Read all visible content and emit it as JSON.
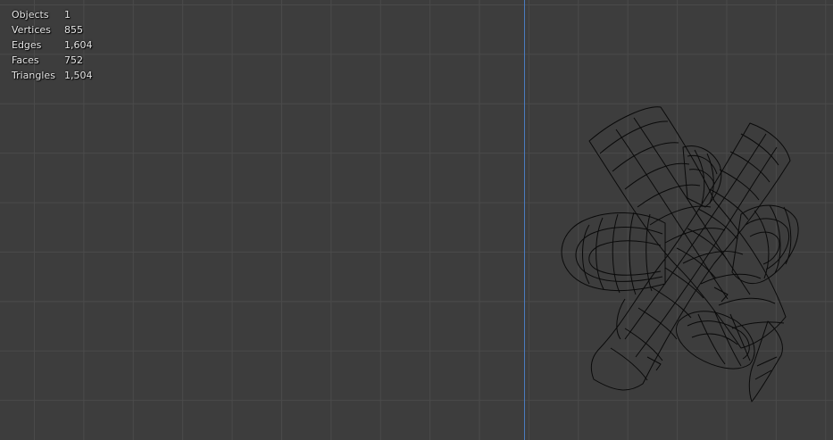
{
  "stats": {
    "rows": [
      {
        "label": "Objects",
        "value": "1"
      },
      {
        "label": "Vertices",
        "value": "855"
      },
      {
        "label": "Edges",
        "value": "1,604"
      },
      {
        "label": "Faces",
        "value": "752"
      },
      {
        "label": "Triangles",
        "value": "1,504"
      }
    ]
  },
  "colors": {
    "background": "#3d3d3d",
    "grid": "#4a4a4a",
    "axis": "#4a7bbf",
    "wire": "#0a0a0a",
    "text": "#e6e6e6"
  },
  "mesh_icon": "wireframe-mesh-icon"
}
